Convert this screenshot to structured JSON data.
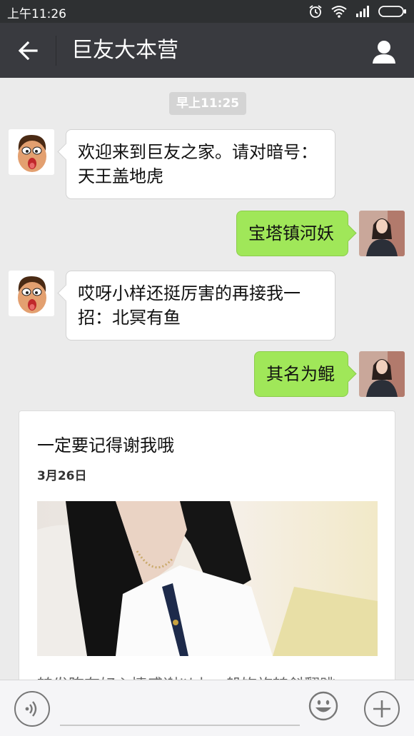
{
  "status_bar": {
    "time": "上午11:26",
    "icons": [
      "alarm-icon",
      "wifi-icon",
      "signal-icon",
      "battery-icon"
    ]
  },
  "header": {
    "title": "巨友大本营",
    "back_icon": "back-arrow-icon",
    "profile_icon": "person-icon"
  },
  "chat": {
    "timestamp": "早上11:25",
    "messages": [
      {
        "side": "in",
        "text": "欢迎来到巨友之家。请对暗号：天王盖地虎"
      },
      {
        "side": "out",
        "text": "宝塔镇河妖"
      },
      {
        "side": "in",
        "text": "哎呀小样还挺厉害的再接我一招：北冥有鱼"
      },
      {
        "side": "out",
        "text": "其名为鲲"
      }
    ],
    "card": {
      "title": "一定要记得谢我哦",
      "date": "3月26日",
      "snippet": "转发陈有好心情感谢以上一般饰旋转斜翻跳"
    }
  },
  "input_bar": {
    "voice_icon": "voice-icon",
    "emoji_icon": "emoji-icon",
    "plus_icon": "plus-icon",
    "input_value": ""
  },
  "colors": {
    "header_bg": "#393a3f",
    "status_bg": "#2e3032",
    "chat_bg": "#ebebeb",
    "outgoing_bubble": "#a0e759",
    "incoming_bubble": "#ffffff"
  }
}
